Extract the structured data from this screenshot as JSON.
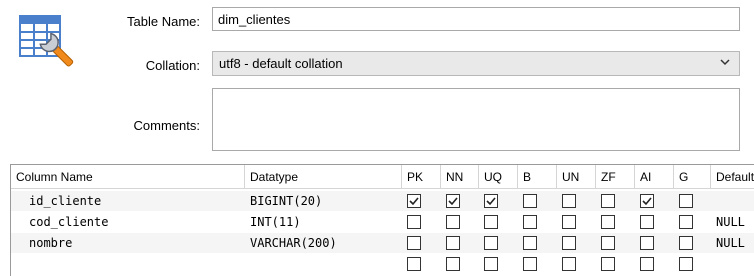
{
  "form": {
    "table_name_label": "Table Name:",
    "table_name_value": "dim_clientes",
    "collation_label": "Collation:",
    "collation_value": "utf8 - default collation",
    "comments_label": "Comments:",
    "comments_value": ""
  },
  "icons": {
    "app": "table-wrench-icon",
    "dropdown": "chevron-down-icon",
    "check": "checkmark-icon"
  },
  "colors": {
    "icon_blue": "#4a7fcb",
    "wrench_orange": "#f08a1c",
    "alt_row": "#f5f5f5",
    "select_bg": "#e9e9e9"
  },
  "columns": {
    "headers": [
      "Column Name",
      "Datatype",
      "PK",
      "NN",
      "UQ",
      "B",
      "UN",
      "ZF",
      "AI",
      "G",
      "Default/Expression"
    ],
    "rows": [
      {
        "name": "id_cliente",
        "datatype": "BIGINT(20)",
        "flags": [
          true,
          true,
          true,
          false,
          false,
          false,
          true,
          false
        ],
        "default": ""
      },
      {
        "name": "cod_cliente",
        "datatype": "INT(11)",
        "flags": [
          false,
          false,
          false,
          false,
          false,
          false,
          false,
          false
        ],
        "default": "NULL"
      },
      {
        "name": "nombre",
        "datatype": "VARCHAR(200)",
        "flags": [
          false,
          false,
          false,
          false,
          false,
          false,
          false,
          false
        ],
        "default": "NULL"
      },
      {
        "name": "",
        "datatype": "",
        "flags": [
          false,
          false,
          false,
          false,
          false,
          false,
          false,
          false
        ],
        "default": ""
      }
    ]
  }
}
